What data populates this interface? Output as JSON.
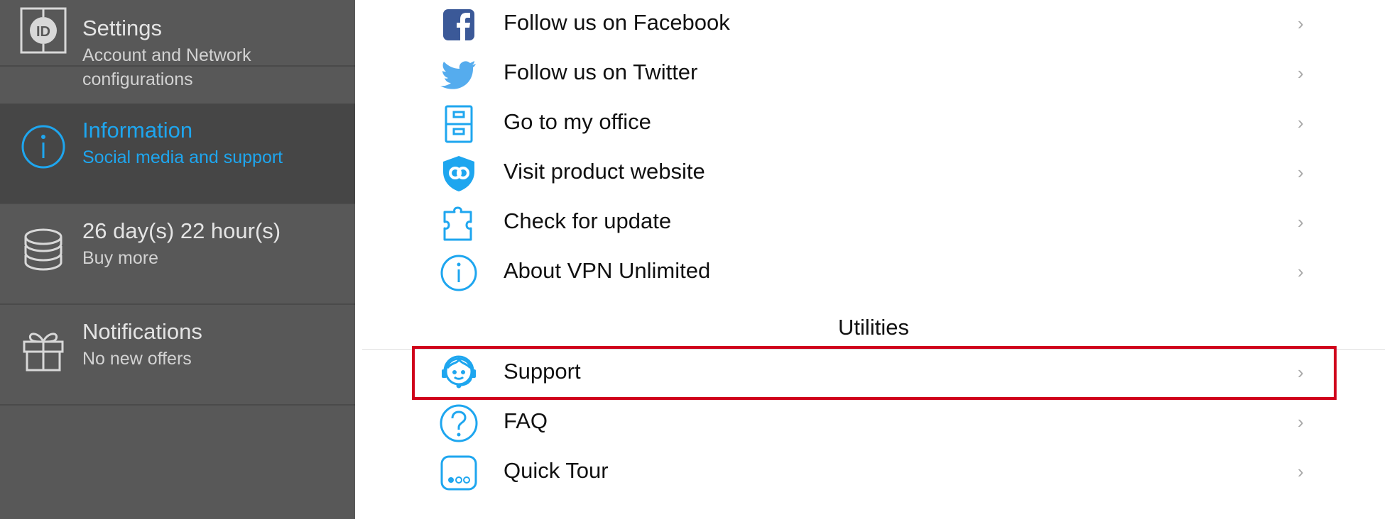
{
  "colors": {
    "accent": "#1ea6ef",
    "sidebar_bg": "#585858",
    "sidebar_active_bg": "#464646",
    "highlight": "#d0021b"
  },
  "sidebar": {
    "items": [
      {
        "icon": "id-icon",
        "title": "Settings",
        "subtitle": "Account and Network configurations",
        "active": false
      },
      {
        "icon": "info-icon",
        "title": "Information",
        "subtitle": "Social media and support",
        "active": true
      },
      {
        "icon": "coins-icon",
        "title": "26 day(s) 22 hour(s)",
        "subtitle": "Buy more",
        "active": false
      },
      {
        "icon": "gift-icon",
        "title": "Notifications",
        "subtitle": "No new offers",
        "active": false
      }
    ]
  },
  "main": {
    "items": [
      {
        "icon": "facebook-icon",
        "label": "Follow us on Facebook"
      },
      {
        "icon": "twitter-icon",
        "label": "Follow us on Twitter"
      },
      {
        "icon": "cabinet-icon",
        "label": "Go to my office"
      },
      {
        "icon": "shield-icon",
        "label": "Visit product website"
      },
      {
        "icon": "puzzle-icon",
        "label": "Check for update"
      },
      {
        "icon": "info-icon",
        "label": "About VPN Unlimited"
      }
    ],
    "utilities": {
      "title": "Utilities",
      "items": [
        {
          "icon": "support-agent-icon",
          "label": "Support",
          "highlighted": true
        },
        {
          "icon": "question-icon",
          "label": "FAQ"
        },
        {
          "icon": "tour-icon",
          "label": "Quick Tour"
        }
      ]
    },
    "chevron": "›"
  }
}
